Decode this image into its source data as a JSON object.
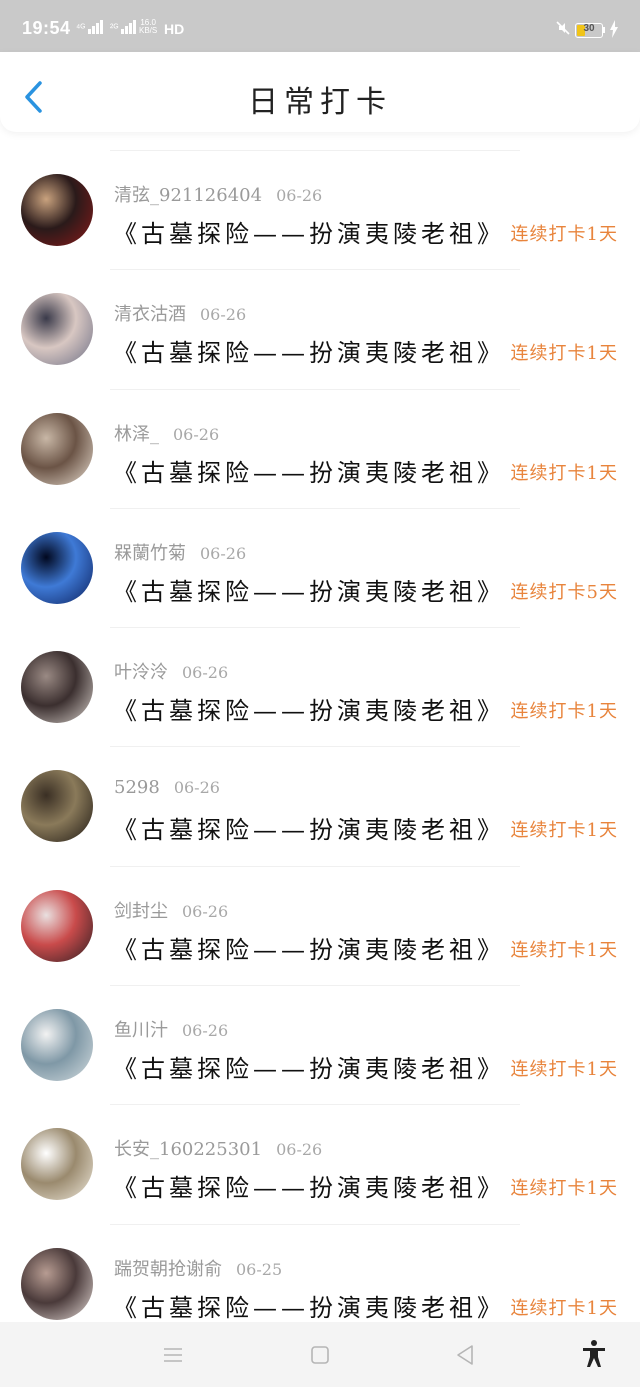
{
  "status_bar": {
    "time": "19:54",
    "signal1": "⁴ᴳ",
    "signal2": "²ᴳ",
    "speed_top": "16.0",
    "speed_bottom": "KB/S",
    "hd": "HD",
    "battery": "30"
  },
  "header": {
    "title": "日常打卡"
  },
  "entries": [
    {
      "user": "清弦_921126404",
      "date": "06-26",
      "book": "《古墓探险——扮演夷陵老祖》",
      "streak": "连续打卡1天",
      "avatar_colors": [
        "#8b1a1a",
        "#2a1a1a",
        "#c9a27e"
      ]
    },
    {
      "user": "清衣沽酒",
      "date": "06-26",
      "book": "《古墓探险——扮演夷陵老祖》",
      "streak": "连续打卡1天",
      "avatar_colors": [
        "#6d6f85",
        "#d8c7c2",
        "#3a3a4a"
      ]
    },
    {
      "user": "林泽_",
      "date": "06-26",
      "book": "《古墓探险——扮演夷陵老祖》",
      "streak": "连续打卡1天",
      "avatar_colors": [
        "#e8ddd0",
        "#6b5446",
        "#c8b7a6"
      ]
    },
    {
      "user": "槑蘭竹菊",
      "date": "06-26",
      "book": "《古墓探险——扮演夷陵老祖》",
      "streak": "连续打卡5天",
      "avatar_colors": [
        "#0b1f5c",
        "#3f7ad6",
        "#01081f"
      ]
    },
    {
      "user": "叶泠泠",
      "date": "06-26",
      "book": "《古墓探险——扮演夷陵老祖》",
      "streak": "连续打卡1天",
      "avatar_colors": [
        "#d9d2cc",
        "#3b2f2f",
        "#9a8a84"
      ]
    },
    {
      "user": "5298",
      "date": "06-26",
      "book": "《古墓探险——扮演夷陵老祖》",
      "streak": "连续打卡1天",
      "avatar_colors": [
        "#1d1712",
        "#8a7a5a",
        "#3a2f24"
      ]
    },
    {
      "user": "剑封尘",
      "date": "06-26",
      "book": "《古墓探险——扮演夷陵老祖》",
      "streak": "连续打卡1天",
      "avatar_colors": [
        "#2b1e22",
        "#c94b4b",
        "#e9e0e0"
      ]
    },
    {
      "user": "鱼川汁",
      "date": "06-26",
      "book": "《古墓探险——扮演夷陵老祖》",
      "streak": "连续打卡1天",
      "avatar_colors": [
        "#d5dde0",
        "#7f98a6",
        "#f2f2f2"
      ]
    },
    {
      "user": "长安_160225301",
      "date": "06-26",
      "book": "《古墓探险——扮演夷陵老祖》",
      "streak": "连续打卡1天",
      "avatar_colors": [
        "#efe9dc",
        "#9a8a6e",
        "#ffffff"
      ]
    },
    {
      "user": "踹贺朝抢谢俞",
      "date": "06-25",
      "book": "《古墓探险——扮演夷陵老祖》",
      "streak": "连续打卡1天",
      "avatar_colors": [
        "#e6dcd8",
        "#4a3a3a",
        "#b79c92"
      ]
    }
  ],
  "colors": {
    "accent": "#2a93e0",
    "streak": "#e8843c",
    "status_bg": "#c9c9c9"
  }
}
